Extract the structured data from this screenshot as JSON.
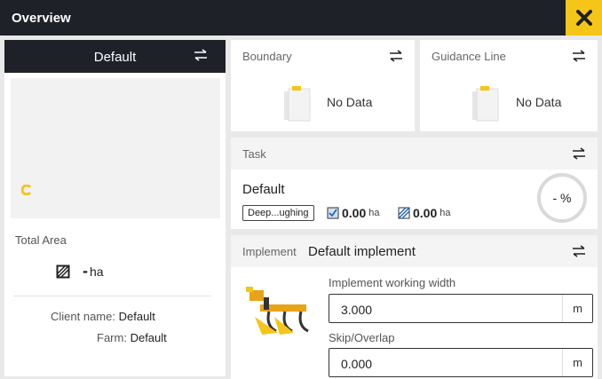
{
  "header": {
    "title": "Overview"
  },
  "left": {
    "profile_name": "Default",
    "total_area_label": "Total Area",
    "total_area_value": "-",
    "total_area_unit": "ha",
    "client_label": "Client name:",
    "client_value": "Default",
    "farm_label": "Farm:",
    "farm_value": "Default"
  },
  "boundary": {
    "label": "Boundary",
    "status": "No Data"
  },
  "guidance": {
    "label": "Guidance Line",
    "status": "No Data"
  },
  "task": {
    "label": "Task",
    "name": "Default",
    "operation": "Deep...ughing",
    "worked_area": "0.00",
    "worked_unit": "ha",
    "covered_area": "0.00",
    "covered_unit": "ha",
    "progress": "- %"
  },
  "implement": {
    "label": "Implement",
    "name": "Default implement",
    "width_label": "Implement working width",
    "width_value": "3.000",
    "width_unit": "m",
    "skip_label": "Skip/Overlap",
    "skip_value": "0.000",
    "skip_unit": "m"
  },
  "colors": {
    "accent": "#f5c518",
    "header_bg": "#1f2129"
  }
}
